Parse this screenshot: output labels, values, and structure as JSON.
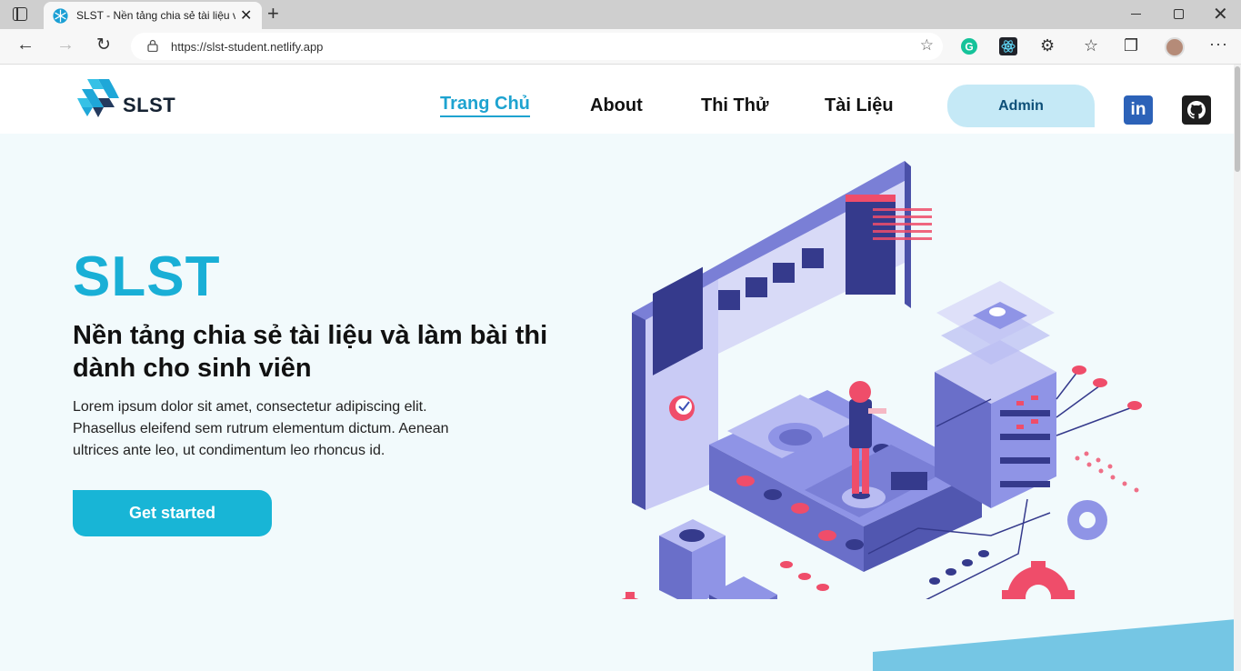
{
  "browser": {
    "tab_title": "SLST - Nền tảng chia sẻ tài liệu v",
    "url": "https://slst-student.netlify.app"
  },
  "site": {
    "logo_text": "SLST",
    "nav": [
      {
        "label": "Trang Chủ",
        "active": true
      },
      {
        "label": "About"
      },
      {
        "label": "Thi Thử"
      },
      {
        "label": "Tài Liệu"
      }
    ],
    "admin_label": "Admin",
    "linkedin_label": "in"
  },
  "hero": {
    "title": "SLST",
    "subtitle": "Nền tảng chia sẻ tài liệu và làm bài thi dành cho sinh viên",
    "description": "Lorem ipsum dolor sit amet, consectetur adipiscing elit. Phasellus eleifend sem rutrum elementum dictum. Aenean ultrices ante leo, ut condimentum leo rhoncus id.",
    "cta_label": "Get started"
  },
  "colors": {
    "accent": "#19afd6",
    "admin_bg": "#c5e9f6",
    "page_bg": "#f2fafc"
  }
}
